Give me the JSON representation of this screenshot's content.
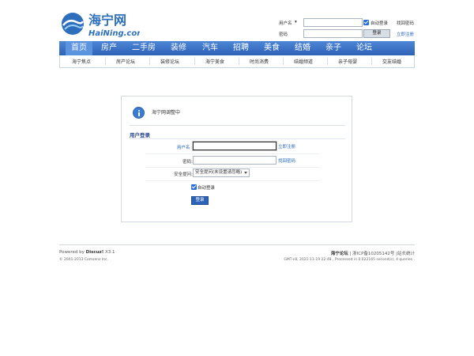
{
  "site": {
    "logo_cn": "海宁网",
    "logo_en": "HaiNing.com"
  },
  "top_login": {
    "username_label": "用户名",
    "password_label": "密码",
    "auto_login": "自动登录",
    "find_password": "找回密码",
    "register": "立即注册",
    "login_button": "登录"
  },
  "nav": {
    "items": [
      "首页",
      "房产",
      "二手房",
      "装修",
      "汽车",
      "招聘",
      "美食",
      "结婚",
      "亲子",
      "论坛"
    ]
  },
  "subnav": {
    "items": [
      "海宁焦点",
      "房产论坛",
      "装修论坛",
      "海宁美食",
      "时尚消费",
      "结婚频道",
      "亲子母婴",
      "交友结婚"
    ]
  },
  "panel": {
    "notice": "海宁网调整中",
    "title": "用户登录",
    "username_label": "用户名 :",
    "register_link": "立即注册",
    "password_label": "密码:",
    "find_password_link": "找回密码",
    "security_label": "安全提问:",
    "security_select": "安全提问(未设置请忽略)",
    "auto_login": "自动登录",
    "login_button": "登录"
  },
  "footer": {
    "powered_prefix": "Powered by",
    "powered_name": "Discuz!",
    "powered_version": "X3.1",
    "copyright": "© 2001-2013 Comsenz Inc.",
    "forum_name": "海宁论坛",
    "icp": "| 浙ICP备10205142号 |站长统计",
    "meta": "GMT+8, 2021-11-19 22:48 , Processed in 0.022165 second(s), 4 queries ."
  }
}
